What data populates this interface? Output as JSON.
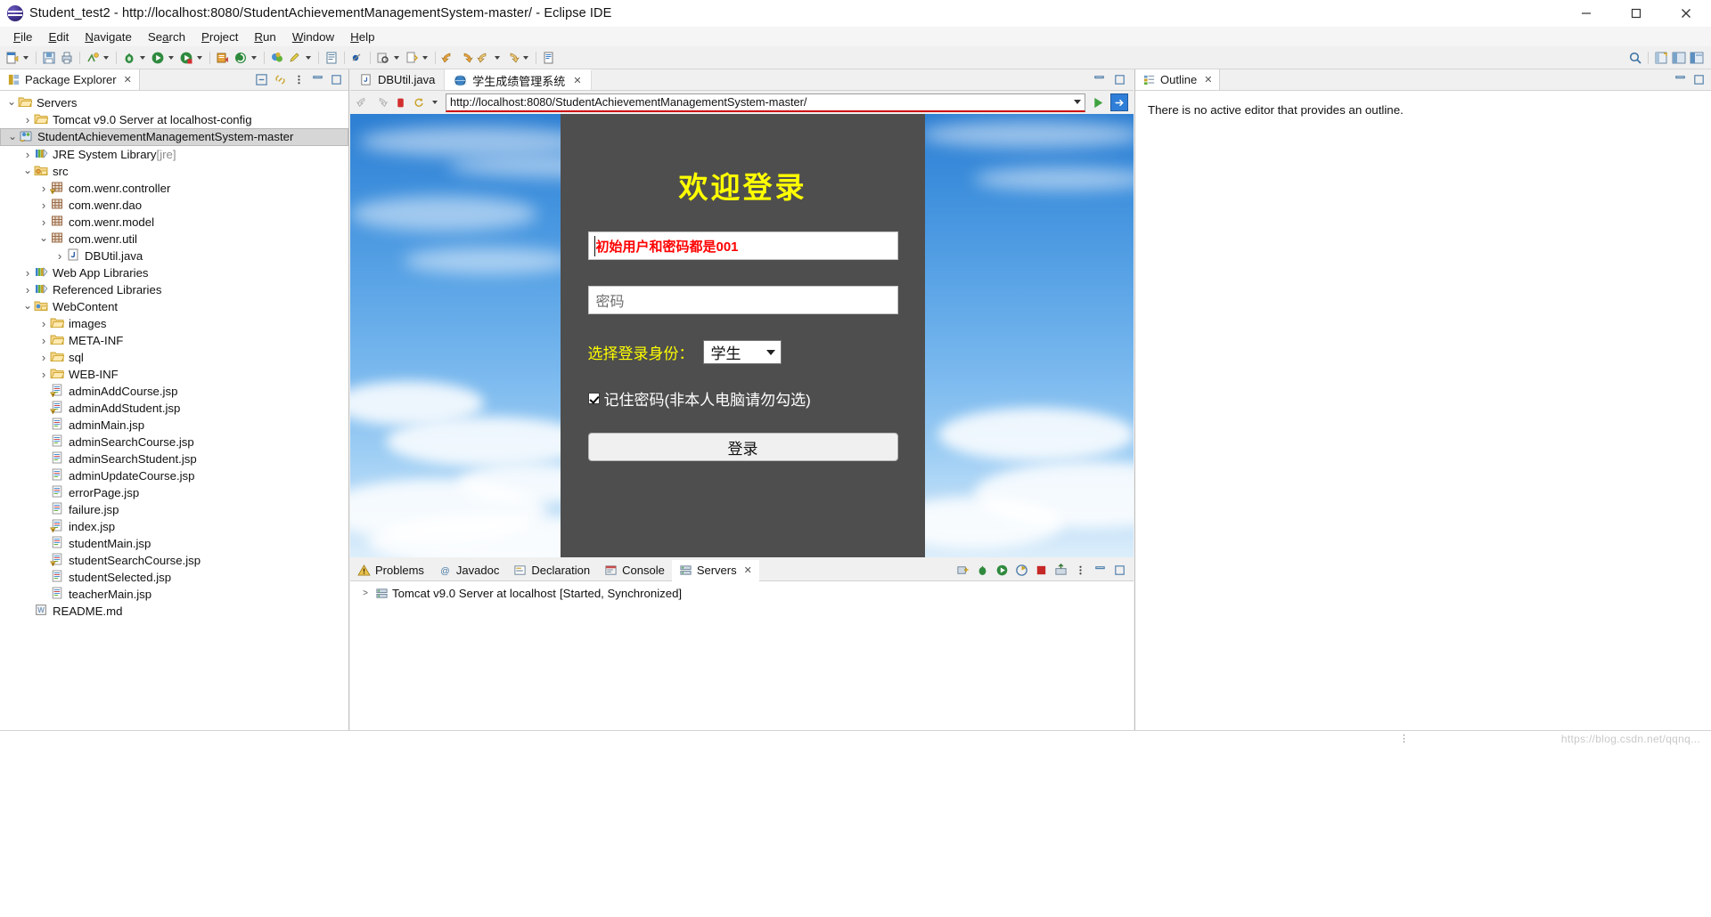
{
  "window": {
    "title": "Student_test2 - http://localhost:8080/StudentAchievementManagementSystem-master/ - Eclipse IDE",
    "minimize_label": "Minimize",
    "maximize_label": "Maximize",
    "close_label": "Close"
  },
  "menubar": {
    "items": [
      {
        "label": "File",
        "mnemonic": "F"
      },
      {
        "label": "Edit",
        "mnemonic": "E"
      },
      {
        "label": "Navigate",
        "mnemonic": "N"
      },
      {
        "label": "Search",
        "mnemonic": "a"
      },
      {
        "label": "Project",
        "mnemonic": "P"
      },
      {
        "label": "Run",
        "mnemonic": "R"
      },
      {
        "label": "Window",
        "mnemonic": "W"
      },
      {
        "label": "Help",
        "mnemonic": "H"
      }
    ]
  },
  "toolbar": {
    "icons": [
      "new-wizard-icon",
      "save-icon",
      "print-icon",
      "build-all-icon",
      "debug-icon",
      "run-icon",
      "coverage-icon",
      "new-java-project-icon",
      "external-tools-icon",
      "open-perspective-icon",
      "edit-icon",
      "toggle-block-selection-icon",
      "skip-breakpoints-icon",
      "search-icon",
      "next-annotation-icon",
      "back-icon",
      "forward-icon",
      "previous-edit-icon",
      "last-edit-icon",
      "link-editor-icon"
    ],
    "right_icons": [
      "quick-access-search-icon",
      "open-perspective-icon",
      "java-perspective-icon",
      "java-ee-perspective-icon"
    ]
  },
  "package_explorer": {
    "tab_label": "Package Explorer",
    "tab_close": "✕",
    "tools": [
      "collapse-all-icon",
      "link-with-editor-icon",
      "view-menu-icon",
      "minimize-icon",
      "maximize-icon"
    ],
    "tree": [
      {
        "label": "Servers",
        "indent": 0,
        "twist": "v",
        "icon": "folder-open-icon",
        "selected": false
      },
      {
        "label": "Tomcat v9.0 Server at localhost-config",
        "indent": 1,
        "twist": ">",
        "icon": "folder-open-icon",
        "selected": false
      },
      {
        "label": "StudentAchievementManagementSystem-master",
        "indent": 0,
        "twist": "v",
        "icon": "web-project-icon",
        "selected": true
      },
      {
        "label": "JRE System Library",
        "suffix": " [jre]",
        "indent": 1,
        "twist": ">",
        "icon": "library-icon",
        "selected": false
      },
      {
        "label": "src",
        "indent": 1,
        "twist": "v",
        "icon": "source-folder-icon",
        "selected": false
      },
      {
        "label": "com.wenr.controller",
        "indent": 2,
        "twist": ">",
        "icon": "package-warning-icon",
        "selected": false
      },
      {
        "label": "com.wenr.dao",
        "indent": 2,
        "twist": ">",
        "icon": "package-icon",
        "selected": false
      },
      {
        "label": "com.wenr.model",
        "indent": 2,
        "twist": ">",
        "icon": "package-icon",
        "selected": false
      },
      {
        "label": "com.wenr.util",
        "indent": 2,
        "twist": "v",
        "icon": "package-icon",
        "selected": false
      },
      {
        "label": "DBUtil.java",
        "indent": 3,
        "twist": ">",
        "icon": "java-file-icon",
        "selected": false
      },
      {
        "label": "Web App Libraries",
        "indent": 1,
        "twist": ">",
        "icon": "library-icon",
        "selected": false
      },
      {
        "label": "Referenced Libraries",
        "indent": 1,
        "twist": ">",
        "icon": "library-icon",
        "selected": false
      },
      {
        "label": "WebContent",
        "indent": 1,
        "twist": "v",
        "icon": "webcontent-folder-icon",
        "selected": false
      },
      {
        "label": "images",
        "indent": 2,
        "twist": ">",
        "icon": "folder-open-icon",
        "selected": false
      },
      {
        "label": "META-INF",
        "indent": 2,
        "twist": ">",
        "icon": "folder-open-icon",
        "selected": false
      },
      {
        "label": "sql",
        "indent": 2,
        "twist": ">",
        "icon": "folder-open-icon",
        "selected": false
      },
      {
        "label": "WEB-INF",
        "indent": 2,
        "twist": ">",
        "icon": "folder-open-icon",
        "selected": false
      },
      {
        "label": "adminAddCourse.jsp",
        "indent": 2,
        "twist": "",
        "icon": "jsp-warning-icon",
        "selected": false
      },
      {
        "label": "adminAddStudent.jsp",
        "indent": 2,
        "twist": "",
        "icon": "jsp-warning-icon",
        "selected": false
      },
      {
        "label": "adminMain.jsp",
        "indent": 2,
        "twist": "",
        "icon": "jsp-file-icon",
        "selected": false
      },
      {
        "label": "adminSearchCourse.jsp",
        "indent": 2,
        "twist": "",
        "icon": "jsp-file-icon",
        "selected": false
      },
      {
        "label": "adminSearchStudent.jsp",
        "indent": 2,
        "twist": "",
        "icon": "jsp-file-icon",
        "selected": false
      },
      {
        "label": "adminUpdateCourse.jsp",
        "indent": 2,
        "twist": "",
        "icon": "jsp-file-icon",
        "selected": false
      },
      {
        "label": "errorPage.jsp",
        "indent": 2,
        "twist": "",
        "icon": "jsp-file-icon",
        "selected": false
      },
      {
        "label": "failure.jsp",
        "indent": 2,
        "twist": "",
        "icon": "jsp-file-icon",
        "selected": false
      },
      {
        "label": "index.jsp",
        "indent": 2,
        "twist": "",
        "icon": "jsp-warning-icon",
        "selected": false
      },
      {
        "label": "studentMain.jsp",
        "indent": 2,
        "twist": "",
        "icon": "jsp-file-icon",
        "selected": false
      },
      {
        "label": "studentSearchCourse.jsp",
        "indent": 2,
        "twist": "",
        "icon": "jsp-warning-icon",
        "selected": false
      },
      {
        "label": "studentSelected.jsp",
        "indent": 2,
        "twist": "",
        "icon": "jsp-file-icon",
        "selected": false
      },
      {
        "label": "teacherMain.jsp",
        "indent": 2,
        "twist": "",
        "icon": "jsp-file-icon",
        "selected": false
      },
      {
        "label": "README.md",
        "indent": 1,
        "twist": "",
        "icon": "markdown-file-icon",
        "selected": false
      }
    ]
  },
  "editor": {
    "tabs": [
      {
        "label": "DBUtil.java",
        "icon": "java-file-icon",
        "active": false,
        "closable": false
      },
      {
        "label": "学生成绩管理系统",
        "icon": "browser-globe-icon",
        "active": true,
        "closable": true,
        "close": "✕"
      }
    ],
    "tools": [
      "minimize-icon",
      "maximize-icon"
    ]
  },
  "browser": {
    "back_icon": "back-arrow-icon",
    "forward_icon": "forward-arrow-icon",
    "stop_icon": "stop-icon",
    "refresh_icon": "refresh-icon",
    "url": "http://localhost:8080/StudentAchievementManagementSystem-master/",
    "go_icon": "run-green-arrow-icon",
    "open-external_icon": "open-external-browser-icon"
  },
  "login_page": {
    "title": "欢迎登录",
    "username_value": "初始用户和密码都是001",
    "password_placeholder": "密码",
    "role_label": "选择登录身份：",
    "role_selected": "学生",
    "remember_label": "记住密码(非本人电脑请勿勾选)",
    "remember_checked": true,
    "login_button": "登录",
    "colors": {
      "title": "#ffff00",
      "username_text": "#ff0000",
      "panel_bg": "#4e4e4e",
      "label": "#ffff00"
    }
  },
  "outline": {
    "tab_label": "Outline",
    "tab_close": "✕",
    "message": "There is no active editor that provides an outline.",
    "tools": [
      "minimize-icon",
      "maximize-icon"
    ]
  },
  "bottom": {
    "tabs": [
      {
        "label": "Problems",
        "icon": "problems-icon",
        "active": false
      },
      {
        "label": "Javadoc",
        "icon": "javadoc-icon",
        "active": false
      },
      {
        "label": "Declaration",
        "icon": "declaration-icon",
        "active": false
      },
      {
        "label": "Console",
        "icon": "console-icon",
        "active": false
      },
      {
        "label": "Servers",
        "icon": "servers-icon",
        "active": true,
        "close": "✕"
      }
    ],
    "tools": [
      "new-server-icon",
      "debug-server-icon",
      "start-server-icon",
      "profile-server-icon",
      "stop-server-icon",
      "publish-icon",
      "view-menu-icon",
      "minimize-icon",
      "maximize-icon"
    ],
    "server_row": {
      "twist": ">",
      "icon": "server-icon",
      "name": "Tomcat v9.0 Server at localhost",
      "status": "[Started, Synchronized]"
    }
  },
  "statusbar": {
    "watermark": "https://blog.csdn.net/qqnq..."
  }
}
